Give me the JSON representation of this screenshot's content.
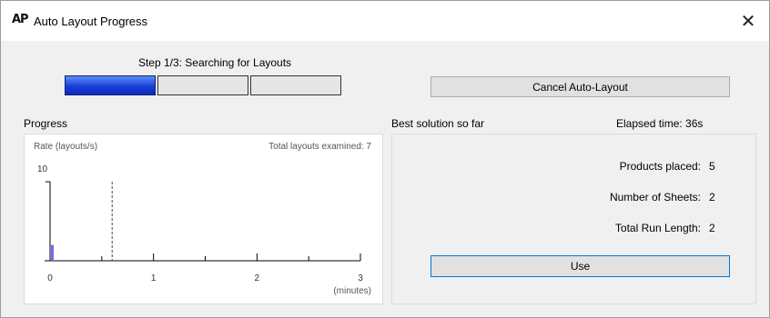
{
  "window": {
    "icon_text": "AP",
    "title": "Auto Layout Progress",
    "close_glyph": "✕"
  },
  "step": {
    "label": "Step 1/3: Searching for Layouts",
    "segments": [
      {
        "state": "active"
      },
      {
        "state": "pending"
      },
      {
        "state": "pending"
      }
    ]
  },
  "buttons": {
    "cancel": "Cancel Auto-Layout",
    "use": "Use"
  },
  "progress": {
    "section_label": "Progress",
    "rate_label": "Rate (layouts/s)",
    "total_label": "Total layouts examined: 7",
    "y_max_label": "10"
  },
  "best": {
    "section_label": "Best solution so far",
    "elapsed": "Elapsed time: 36s",
    "stats": [
      {
        "label": "Products placed:",
        "value": "5"
      },
      {
        "label": "Number of Sheets:",
        "value": "2"
      },
      {
        "label": "Total Run Length:",
        "value": "2"
      }
    ]
  },
  "chart_data": {
    "type": "bar",
    "title": "",
    "ylabel": "Rate (layouts/s)",
    "xlabel": "(minutes)",
    "x_ticks": [
      "0",
      "1",
      "2",
      "3"
    ],
    "xlim": [
      0,
      3
    ],
    "ylim": [
      0,
      10
    ],
    "bars": [
      {
        "x": 0.0,
        "value": 2
      }
    ],
    "current_time_marker": 0.6,
    "colors": {
      "bar": "#7b68ee",
      "axis": "#000000"
    }
  }
}
